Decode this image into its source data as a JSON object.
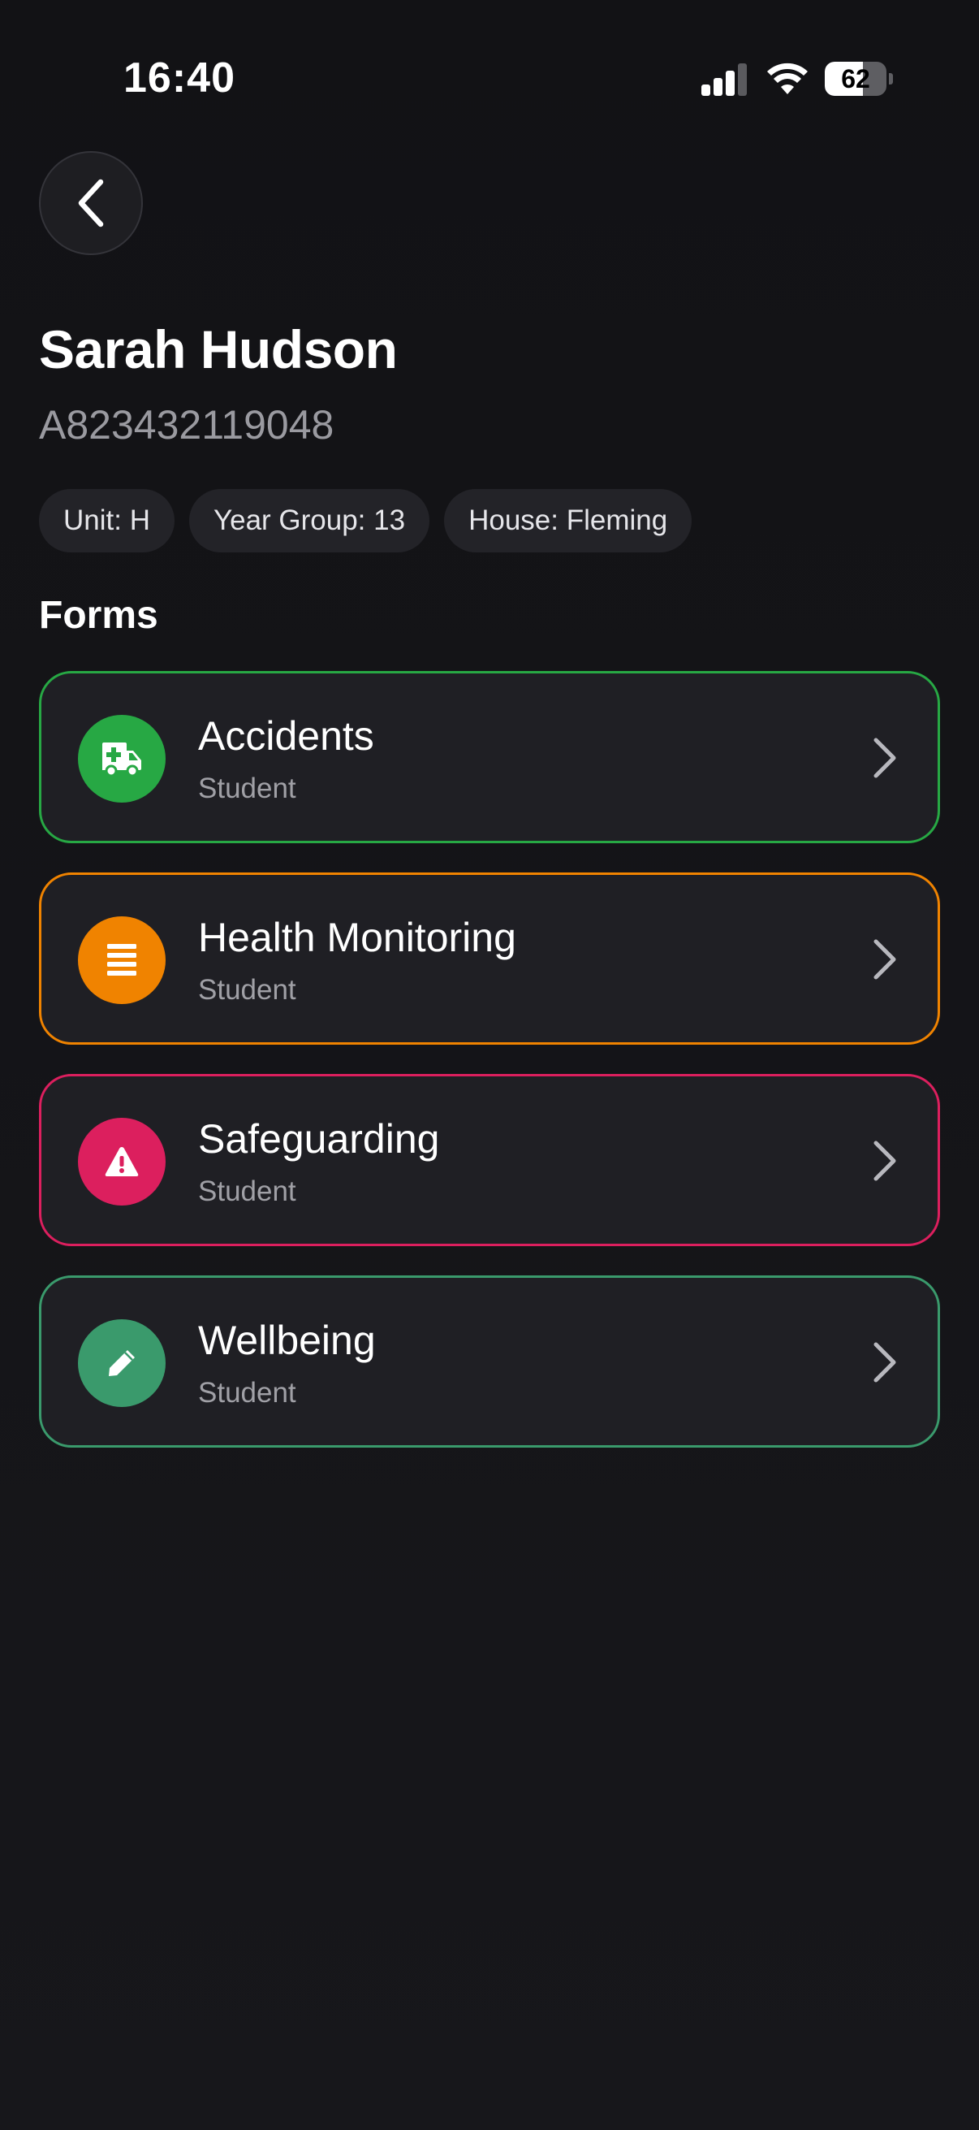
{
  "status_bar": {
    "time": "16:40",
    "battery_level": "62",
    "battery_fraction": 0.62
  },
  "header": {
    "back_icon": "chevron-left-icon",
    "name": "Sarah Hudson",
    "id_number": "A823432119048",
    "chips": [
      {
        "label": "Unit: H"
      },
      {
        "label": "Year Group: 13"
      },
      {
        "label": "House: Fleming"
      }
    ]
  },
  "forms": {
    "section_title": "Forms",
    "items": [
      {
        "title": "Accidents",
        "subtitle": "Student",
        "icon": "ambulance-icon",
        "color": "#27a844"
      },
      {
        "title": "Health Monitoring",
        "subtitle": "Student",
        "icon": "list-icon",
        "color": "#f08300"
      },
      {
        "title": "Safeguarding",
        "subtitle": "Student",
        "icon": "warning-icon",
        "color": "#dc1f5e"
      },
      {
        "title": "Wellbeing",
        "subtitle": "Student",
        "icon": "pencil-icon",
        "color": "#3a9a6c"
      }
    ]
  },
  "colors": {
    "background": "#151519",
    "card": "#1f1f24",
    "chip": "#232328",
    "muted_text": "#a0a0a6"
  }
}
